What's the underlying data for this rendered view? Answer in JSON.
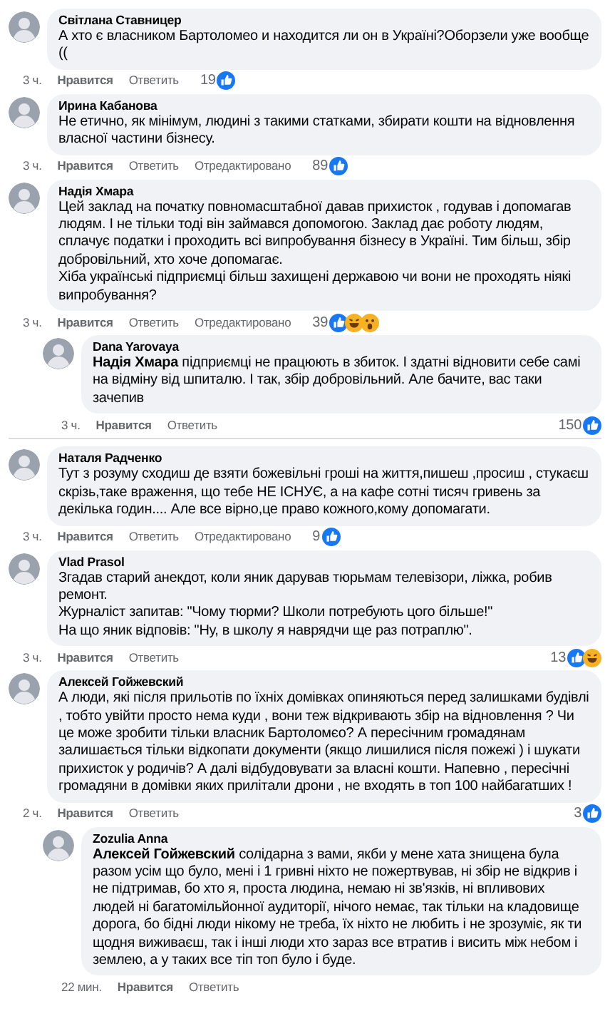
{
  "comments": [
    {
      "kind": "top",
      "author": "Світлана Ставницер",
      "text": "А хто є власником Бартоломео и находится ли он в Україні?Оборзели уже вообще ((",
      "time": "3 ч.",
      "like": "Нравится",
      "reply": "Ответить",
      "reactions_count": "19",
      "reactions": [
        {
          "kind": "like"
        }
      ]
    },
    {
      "kind": "top",
      "author": "Ирина Кабанова",
      "text": "Не етично, як мінімум, людині з такими статками, збирати кошти на відновлення власної частини бізнесу.",
      "time": "3 ч.",
      "like": "Нравится",
      "reply": "Ответить",
      "edited": "Отредактировано",
      "reactions_count": "89",
      "reactions": [
        {
          "kind": "like"
        }
      ]
    },
    {
      "kind": "top",
      "author": "Надія Хмара",
      "text": "Цей заклад на початку повномасштабної давав прихисток , годував і допомагав людям. І не тільки тоді він займався допомогою. Заклад дає роботу людям, сплачує податки і проходить всі випробування бізнесу в Україні. Тим більш, збір добровільний, хто хоче допомагає.\nХіба українські підприємці більш захищені державою чи вони не проходять ніякі випробування?",
      "time": "3 ч.",
      "like": "Нравится",
      "reply": "Ответить",
      "edited": "Отредактировано",
      "reactions_count": "39",
      "reactions": [
        {
          "kind": "like"
        },
        {
          "kind": "haha"
        },
        {
          "kind": "wow"
        }
      ]
    },
    {
      "kind": "reply",
      "author": "Dana Yarovaya",
      "text": "**Надія Хмара** підприємці не працюють в збиток. І здатні відновити себе самі на відміну від шпиталю. І так, збір добровільний. Але бачите, вас таки зачепив",
      "time": "3 ч.",
      "like": "Нравится",
      "reply": "Ответить",
      "reactions_count": "150",
      "reactions": [
        {
          "kind": "like"
        }
      ]
    },
    {
      "kind": "top",
      "author": "Наталя Радченко",
      "text": "Тут з розуму сходиш де взяти божевільні гроші на життя,пишеш ,просиш , стукаєш скрізь,таке враження, що тебе НЕ ІСНУЄ, а на кафе сотні тисяч гривень за декілька годин.... Але все вірно,це право кожного,кому допомагати.",
      "time": "3 ч.",
      "like": "Нравится",
      "reply": "Ответить",
      "edited": "Отредактировано",
      "reactions_count": "9",
      "reactions": [
        {
          "kind": "like"
        }
      ]
    },
    {
      "kind": "top",
      "author": "Vlad Prasol",
      "text": "Згадав старий анекдот, коли яник дарував тюрьмам телевізори, ліжка, робив ремонт.\nЖурналіст запитав: \"Чому тюрми? Школи потребують цого більше!\"\nНа що яник відповів: \"Ну, в школу я наврядчи ще раз потраплю\".",
      "time": "3 ч.",
      "like": "Нравится",
      "reply": "Ответить",
      "reactions_count": "13",
      "reactions": [
        {
          "kind": "like"
        },
        {
          "kind": "haha"
        }
      ]
    },
    {
      "kind": "top",
      "author": "Алексей Гойжевский",
      "text": "А люди, які після прильотів по їхніх домівках опиняються перед залишками будівлі , тобто увійти просто нема куди , вони теж відкривають збір на відновлення ? Чи це може зробити тільки власник Бартоломєо? А пересічним громадянам залишається тільки відкопати документи (якщо лишилися після пожежі ) і шукати прихисток у родичів? А далі відбудовувати за власні кошти. Напевно , пересічні громадяни в домівки яких прилітали дрони , не входять в топ 100 найбагатших !",
      "time": "2 ч.",
      "like": "Нравится",
      "reply": "Ответить",
      "reactions_count": "3",
      "reactions": [
        {
          "kind": "like"
        }
      ]
    },
    {
      "kind": "reply",
      "author": "Zozulia Anna",
      "text": "**Алексей Гойжевский** солідарна з вами, якби у мене хата знищена була разом усім що було, мені і 1 гривні ніхто не пожертвував, ні збір не відкрив і не підтримав, бо хто я, проста людина, немаю ні зв'язків, ні впливових людей ні багатомільйонної аудиторії, нічого немає, так тільки на кладовище дорога, бо бідні люди нікому не треба, їх ніхто не любить і не зрозуміє, як ти щодня виживаєш, так і інші люди хто зараз все втратив і висить між небом і землею, а у таких все тіп топ було і буде.",
      "time": "22 мин.",
      "like": "Нравится",
      "reply": "Ответить"
    }
  ]
}
